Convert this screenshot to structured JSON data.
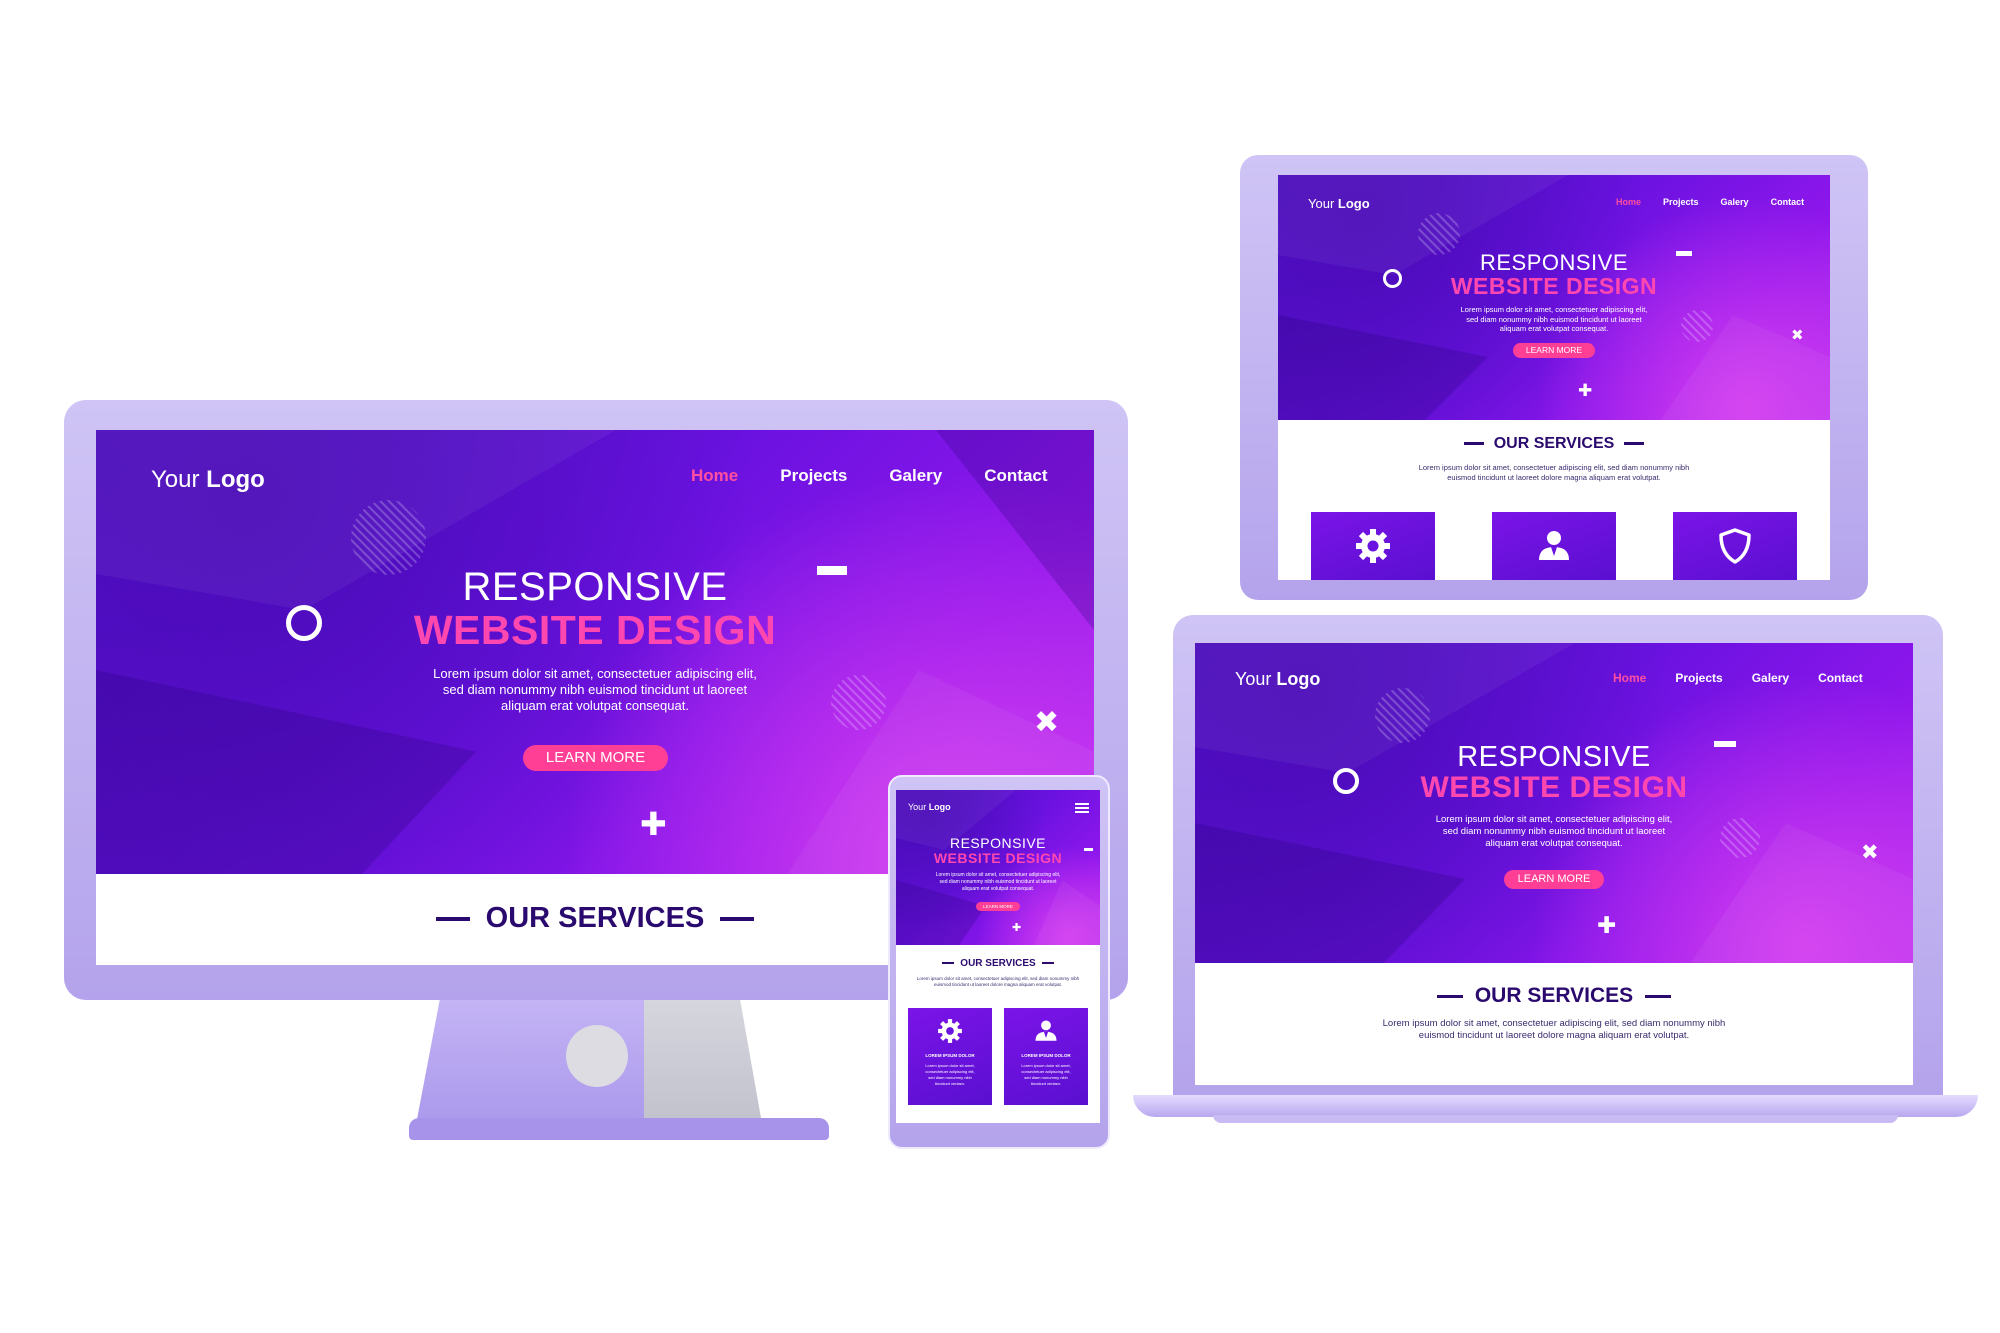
{
  "site": {
    "logo_light": "Your ",
    "logo_bold": "Logo",
    "nav": [
      "Home",
      "Projects",
      "Galery",
      "Contact"
    ],
    "headline_1": "RESPONSIVE",
    "headline_2": "WEBSITE DESIGN",
    "lorem_1": "Lorem ipsum dolor sit amet, consectetuer adipiscing elit,",
    "lorem_2": "sed diam nonummy nibh euismod tincidunt ut laoreet",
    "lorem_3": "aliquam erat volutpat consequat.",
    "cta": "LEARN MORE",
    "services_title": "OUR SERVICES",
    "services_lorem_1": "Lorem ipsum dolor sit amet, consectetuer adipiscing elit, sed diam nonummy nibh",
    "services_lorem_2": "euismod tincidunt ut laoreet dolore magna aliquam erat volutpat.",
    "card_title": "LOREM IPSUM DOLOR",
    "card_text_1": "Lorem ipsum dolor sit amet,",
    "card_text_2": "consectetuer adipiscing elit,",
    "card_text_3": "sed diam nonummy nibh",
    "card_text_4": "tincidunt veniam."
  },
  "icons": {
    "ring": "circle-outline-icon",
    "minus": "minus-icon",
    "close": "x-icon",
    "plus": "plus-icon",
    "menu": "hamburger-menu-icon",
    "services": [
      "gear-icon",
      "user-icon",
      "shield-icon"
    ]
  },
  "colors": {
    "hero_start": "#4d0fc4",
    "hero_end": "#b52ef0",
    "accent_pink": "#ff3f95",
    "services_text": "#2a0a6e",
    "device_frame": "#c2b3f0"
  }
}
